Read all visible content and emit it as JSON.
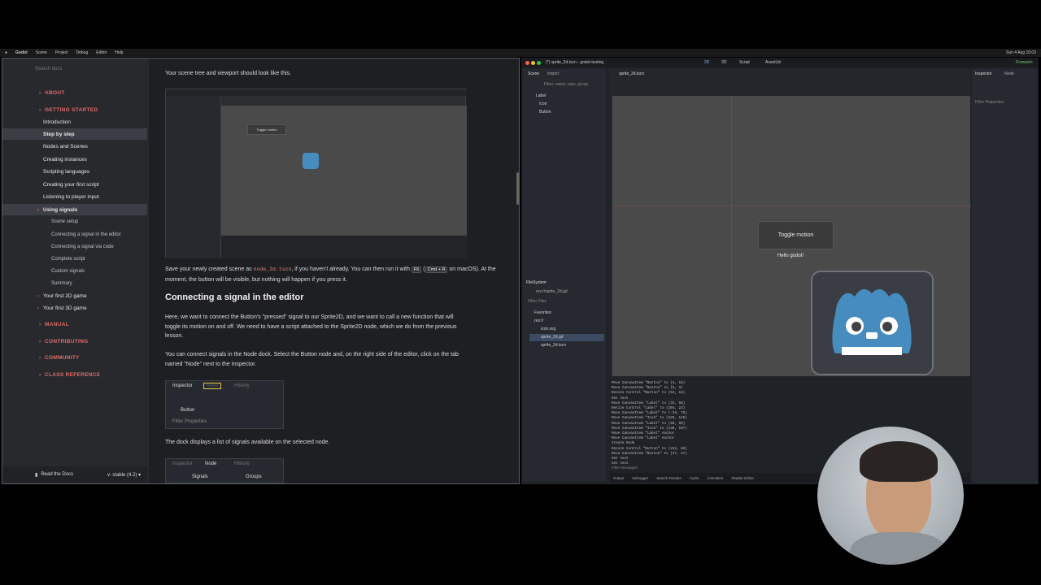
{
  "menubar": {
    "app": "Godot",
    "items": [
      "Scene",
      "Project",
      "Debug",
      "Editor",
      "Help"
    ],
    "clock": "Sun 4 Aug 10:03"
  },
  "docs": {
    "search_placeholder": "Search docs",
    "sidebar": [
      {
        "label": "ABOUT",
        "kind": "cat"
      },
      {
        "label": "GETTING STARTED",
        "kind": "cat"
      },
      {
        "label": "Introduction",
        "kind": "item"
      },
      {
        "label": "Step by step",
        "kind": "item-sel"
      },
      {
        "label": "Nodes and Scenes",
        "kind": "item"
      },
      {
        "label": "Creating instances",
        "kind": "item"
      },
      {
        "label": "Scripting languages",
        "kind": "item"
      },
      {
        "label": "Creating your first script",
        "kind": "item"
      },
      {
        "label": "Listening to player input",
        "kind": "item"
      },
      {
        "label": "Using signals",
        "kind": "item-sel2"
      },
      {
        "label": "Scene setup",
        "kind": "sub"
      },
      {
        "label": "Connecting a signal in the editor",
        "kind": "sub"
      },
      {
        "label": "Connecting a signal via code",
        "kind": "sub"
      },
      {
        "label": "Complete script",
        "kind": "sub"
      },
      {
        "label": "Custom signals",
        "kind": "sub"
      },
      {
        "label": "Summary",
        "kind": "sub"
      },
      {
        "label": "Your first 2D game",
        "kind": "item"
      },
      {
        "label": "Your first 3D game",
        "kind": "item"
      },
      {
        "label": "MANUAL",
        "kind": "cat"
      },
      {
        "label": "CONTRIBUTING",
        "kind": "cat"
      },
      {
        "label": "COMMUNITY",
        "kind": "cat"
      },
      {
        "label": "CLASS REFERENCE",
        "kind": "cat"
      }
    ],
    "footer_left": "Read the Docs",
    "footer_right": "v: stable (4.2) ▾",
    "content": {
      "intro": "Your scene tree and viewport should look like this.",
      "save_pre": "Save your newly created scene as ",
      "save_code": "node_2d.tscn",
      "save_mid": ", if you haven't already. You can then run it with ",
      "save_key1": "F6",
      "save_mid2": " (",
      "save_key2": "Cmd + R",
      "save_post": " on macOS). At the moment, the button will be visible, but nothing will happen if you press it.",
      "heading": "Connecting a signal in the editor",
      "para1": "Here, we want to connect the Button's \"pressed\" signal to our Sprite2D, and we want to call a new function that will toggle its motion on and off. We need to have a script attached to the Sprite2D node, which we do from the previous lesson.",
      "para2": "You can connect signals in the Node dock. Select the Button node and, on the right side of the editor, click on the tab named \"Node\" next to the Inspector.",
      "para3": "The dock displays a list of signals available on the selected node.",
      "inspector_shot": {
        "tabs": [
          "Inspector",
          "Node",
          "History"
        ],
        "node_label": "Button",
        "filter": "Filter Properties"
      },
      "node_shot": {
        "tabs": [
          "Inspector",
          "Node",
          "History"
        ],
        "items": [
          "Signals",
          "Groups"
        ]
      },
      "viewport_shot": {
        "button_text": "Toggle motion"
      }
    }
  },
  "godot": {
    "title": "(*) sprite_2d.tscn - godot-testing",
    "workspaces": [
      "2D",
      "3D",
      "Script",
      "AssetLib"
    ],
    "renderer": "Forward+",
    "scene_tabs": [
      "Scene",
      "Import"
    ],
    "scene_filter": "Filter: name, type, group",
    "scene_tree": [
      "Label",
      "Icon",
      "Button"
    ],
    "editor_tab": "sprite_2d.tscn",
    "filesystem": {
      "title": "FileSystem",
      "path": "res://sprite_2d.gd",
      "filter": "Filter Files",
      "items": [
        "Favorites:",
        "res://",
        "icon.svg",
        "sprite_2d.gd",
        "sprite_2d.tscn"
      ]
    },
    "inspector_tabs": [
      "Inspector",
      "Node"
    ],
    "inspector_filter": "Filter Properties",
    "viewport": {
      "button_text": "Toggle motion",
      "label_text": "Hello godot!"
    },
    "output_lines": [
      "Move CanvasItem \"Button\" to (4, 16)",
      "Move CanvasItem \"Button\" to (5, 3)",
      "Resize Control \"Button\" to (54, 15)",
      "Set text",
      "Move CanvasItem \"Label\" to (32, 56)",
      "Resize Control \"Label\" to (104, 23)",
      "Move CanvasItem \"Label\" to (-34, 75)",
      "Move CanvasItem \"Icon\" to (226, 116)",
      "Move CanvasItem \"Label\" to (50, 60)",
      "Move CanvasItem \"Icon\" to (138, 107)",
      "Move CanvasItem \"Label\" Anchor",
      "Move CanvasItem \"Label\" Anchor",
      "Create Node",
      "Resize Control \"Button\" to (224, 86)",
      "Move CanvasItem \"Button\" to (27, 27)",
      "Set text",
      "Set text"
    ],
    "output_filter": "Filter Messages",
    "bottom_tabs": [
      "Output",
      "Debugger",
      "Search Results",
      "Audio",
      "Animation",
      "Shader Editor"
    ]
  },
  "colors": {
    "accent_red": "#e06a6a",
    "godot_blue": "#478cbf"
  }
}
